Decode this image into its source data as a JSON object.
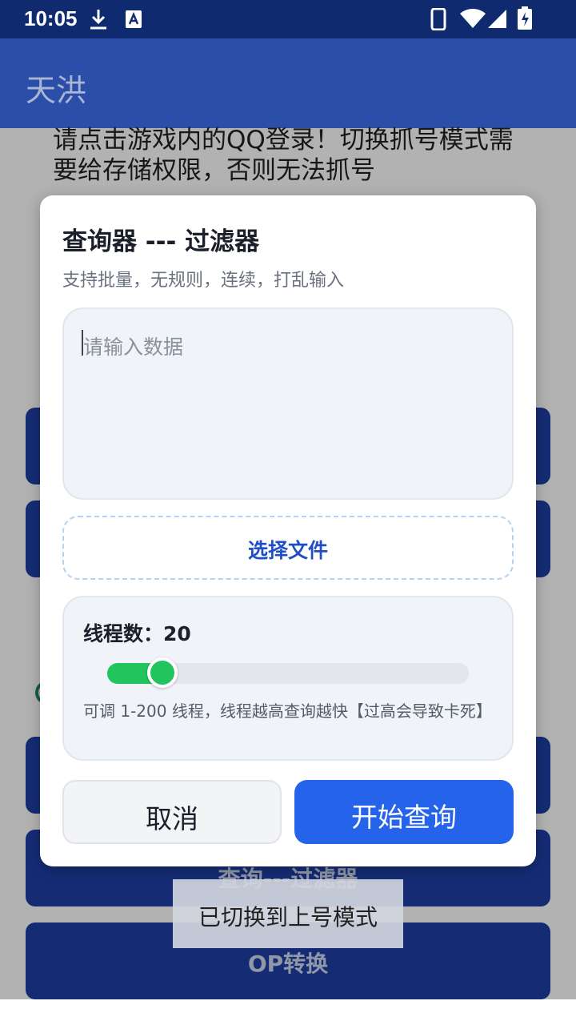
{
  "status_bar": {
    "time": "10:05"
  },
  "app_bar": {
    "title": "天洪"
  },
  "background": {
    "notice": "请点击游戏内的QQ登录！切换抓号模式需要给存储权限，否则无法抓号",
    "buttons": [
      "查询---过滤器",
      "OP转换"
    ]
  },
  "dialog": {
    "title": "查询器 --- 过滤器",
    "subtitle": "支持批量，无规则，连续，打乱输入",
    "input": {
      "placeholder": "请输入数据",
      "value": ""
    },
    "file_button": "选择文件",
    "threads": {
      "label": "线程数：20",
      "value": 20,
      "min": 1,
      "max": 200,
      "hint": "可调 1-200 线程，线程越高查询越快【过高会导致卡死】"
    },
    "cancel_button": "取消",
    "start_button": "开始查询"
  },
  "toast": "已切换到上号模式",
  "colors": {
    "primary": "#2563eb",
    "app_bar": "#2b4fa8",
    "status_bar": "#0f2a6e",
    "slider": "#21c45d"
  }
}
